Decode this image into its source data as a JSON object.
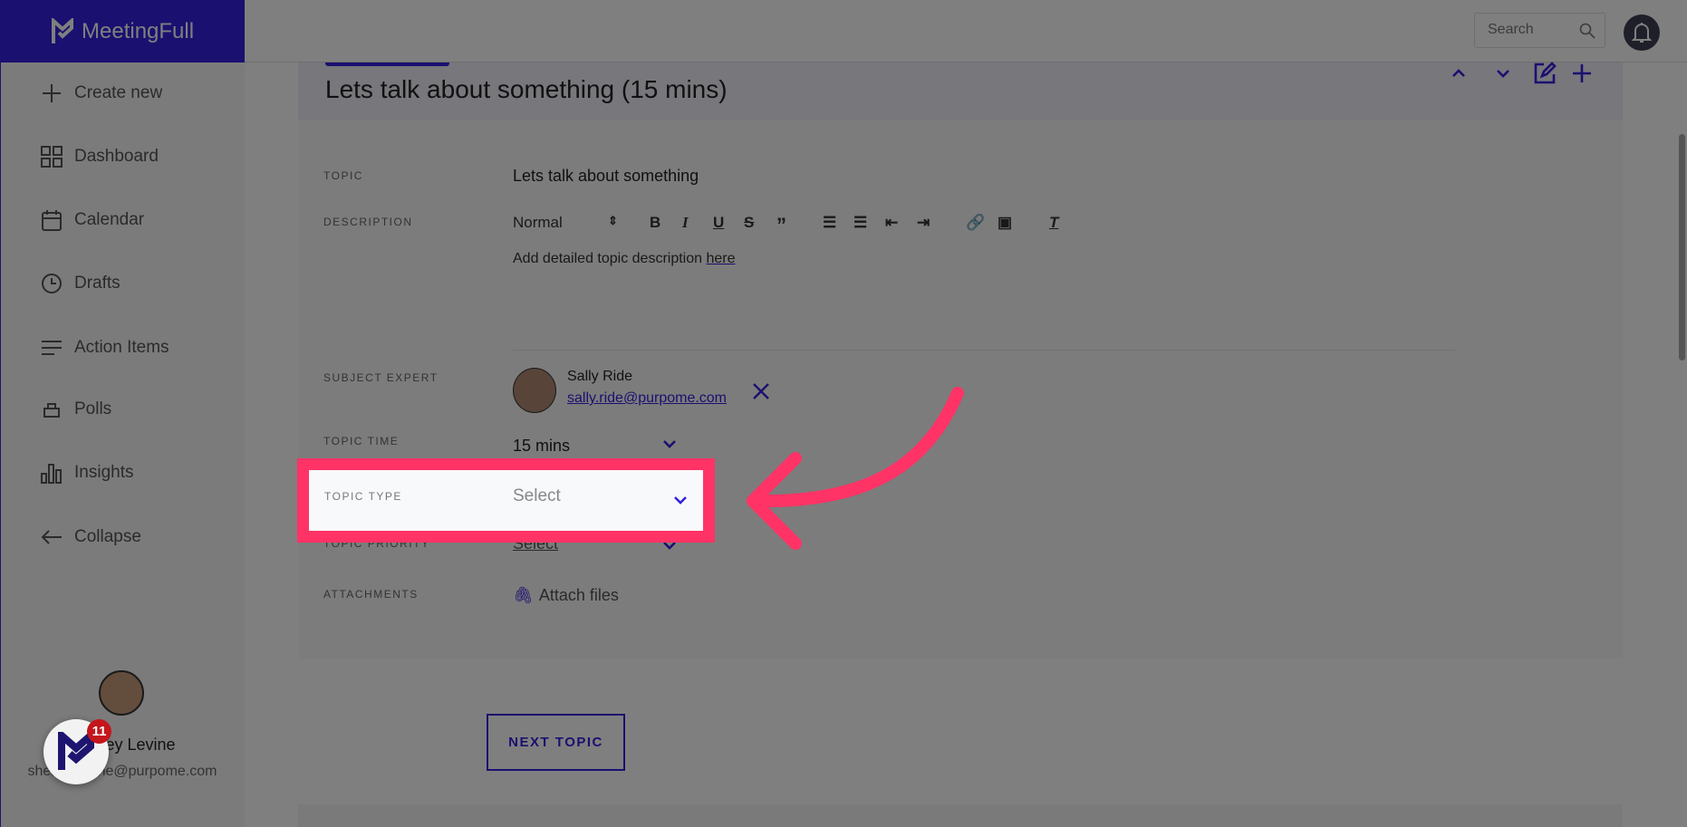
{
  "app": {
    "name": "MeetingFull",
    "accent": "#3521e0",
    "highlight": "#ff3366"
  },
  "topbar": {
    "search_placeholder": "Search"
  },
  "sidebar": {
    "items": [
      {
        "label": "Create new",
        "icon": "plus-icon"
      },
      {
        "label": "Dashboard",
        "icon": "grid-icon"
      },
      {
        "label": "Calendar",
        "icon": "calendar-icon"
      },
      {
        "label": "Drafts",
        "icon": "clock-icon"
      },
      {
        "label": "Action Items",
        "icon": "list-icon"
      },
      {
        "label": "Polls",
        "icon": "poll-icon"
      },
      {
        "label": "Insights",
        "icon": "bar-chart-icon"
      },
      {
        "label": "Collapse",
        "icon": "arrow-left-icon"
      }
    ],
    "user": {
      "name": "Shelley Levine",
      "email": "shelley.levine@purpome.com"
    },
    "badge_count": "11"
  },
  "topic": {
    "title": "Lets talk about something (15 mins)",
    "fields": {
      "topic_label": "TOPIC",
      "topic_value": "Lets talk about something",
      "description_label": "DESCRIPTION",
      "format_value": "Normal",
      "description_text": "Add detailed topic description ",
      "description_link": "here",
      "expert_label": "SUBJECT EXPERT",
      "expert_name": "Sally Ride",
      "expert_email": "sally.ride@purpome.com",
      "time_label": "TOPIC TIME",
      "time_value": "15 mins",
      "type_label": "TOPIC TYPE",
      "type_value": "Select",
      "priority_label": "TOPIC PRIORITY",
      "priority_value": "Select",
      "attachments_label": "ATTACHMENTS",
      "attach_label": "Attach files"
    },
    "next_label": "NEXT TOPIC"
  }
}
